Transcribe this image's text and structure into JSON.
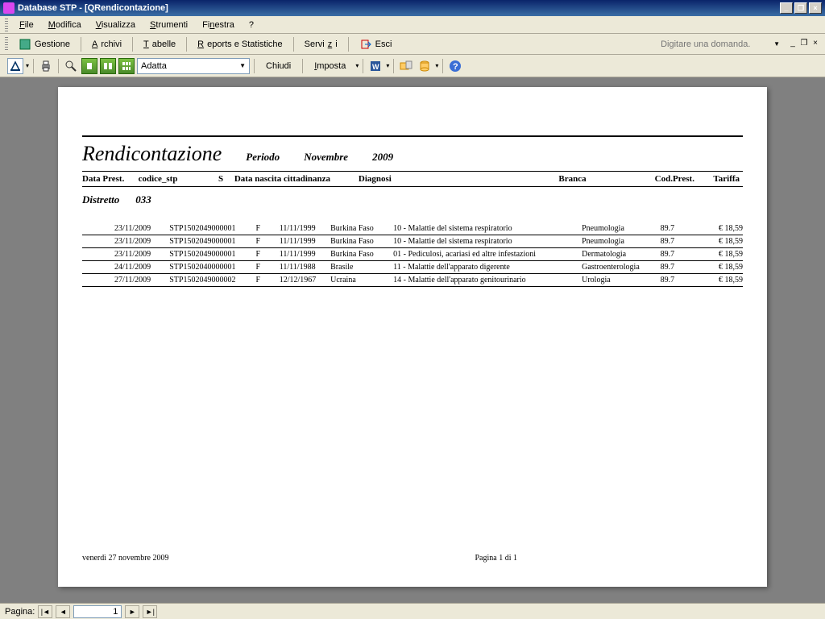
{
  "titlebar": {
    "text": "Database STP - [QRendicontazione]"
  },
  "menu": {
    "file": "File",
    "modifica": "Modifica",
    "visualizza": "Visualizza",
    "strumenti": "Strumenti",
    "finestra": "Finestra",
    "help": "?"
  },
  "toolbar1": {
    "gestione": "Gestione",
    "archivi": "Archivi",
    "tabelle": "Tabelle",
    "reports": "Reports e Statistiche",
    "servizi": "Servizi",
    "esci": "Esci",
    "help_placeholder": "Digitare una domanda."
  },
  "toolbar2": {
    "zoom": "Adatta",
    "chiudi": "Chiudi",
    "imposta": "Imposta"
  },
  "report": {
    "title": "Rendicontazione",
    "period_label": "Periodo",
    "period_month": "Novembre",
    "period_year": "2009",
    "headers": {
      "data": "Data Prest.",
      "codice": "codice_stp",
      "s": "S",
      "nascita": "Data nascita  cittadinanza",
      "diagnosi": "Diagnosi",
      "branca": "Branca",
      "cod": "Cod.Prest.",
      "tariffa": "Tariffa"
    },
    "distretto_label": "Distretto",
    "distretto_value": "033",
    "rows": [
      {
        "data": "23/11/2009",
        "codice": "STP1502049000001",
        "s": "F",
        "nascita": "11/11/1999",
        "citt": "Burkina Faso",
        "diag": "10 - Malattie del sistema respiratorio",
        "branca": "Pneumologia",
        "cod": "89.7",
        "tar": "€ 18,59"
      },
      {
        "data": "23/11/2009",
        "codice": "STP1502049000001",
        "s": "F",
        "nascita": "11/11/1999",
        "citt": "Burkina Faso",
        "diag": "10 - Malattie del sistema respiratorio",
        "branca": "Pneumologia",
        "cod": "89.7",
        "tar": "€ 18,59"
      },
      {
        "data": "23/11/2009",
        "codice": "STP1502049000001",
        "s": "F",
        "nascita": "11/11/1999",
        "citt": "Burkina Faso",
        "diag": "01 - Pediculosi, acariasi ed altre infestazioni",
        "branca": "Dermatologia",
        "cod": "89.7",
        "tar": "€ 18,59"
      },
      {
        "data": "24/11/2009",
        "codice": "STP1502040000001",
        "s": "F",
        "nascita": "11/11/1988",
        "citt": "Brasile",
        "diag": "11 - Malattie dell'apparato digerente",
        "branca": "Gastroenterologia",
        "cod": "89.7",
        "tar": "€ 18,59"
      },
      {
        "data": "27/11/2009",
        "codice": "STP1502049000002",
        "s": "F",
        "nascita": "12/12/1967",
        "citt": "Ucraina",
        "diag": "14 - Malattie dell'apparato genitourinario",
        "branca": "Urologia",
        "cod": "89.7",
        "tar": "€ 18,59"
      }
    ],
    "footer_date": "venerdì 27 novembre 2009",
    "footer_page": "Pagina 1 di 1"
  },
  "statusbar": {
    "label": "Pagina:",
    "value": "1"
  }
}
